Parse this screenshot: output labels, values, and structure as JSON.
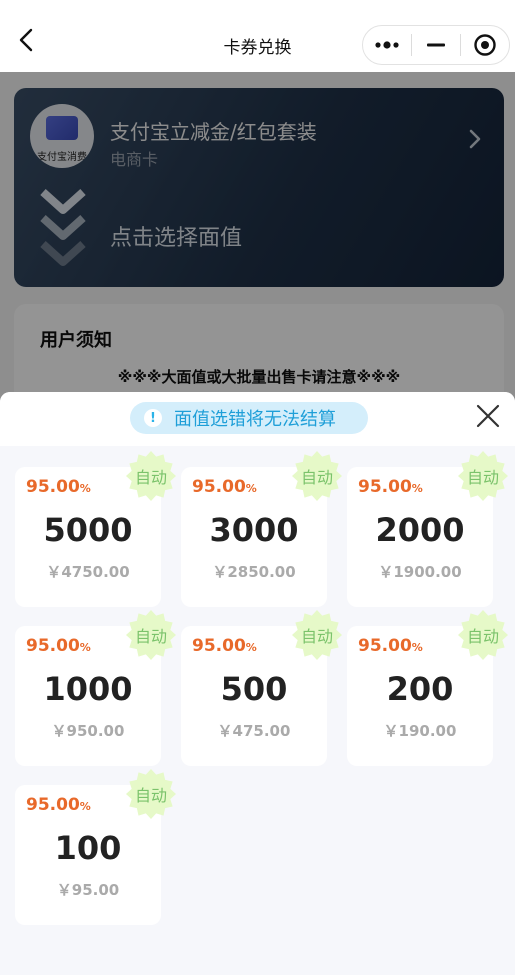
{
  "navbar": {
    "title": "卡券兑换",
    "back_icon": "chevron-left-icon",
    "more_icon": "more-dots-icon",
    "minimize_icon": "minimize-icon",
    "close_icon": "target-circle-icon"
  },
  "card": {
    "thumb_caption": "支付宝消费",
    "name": "支付宝立减金/红包套装",
    "type": "电商卡",
    "select_prompt": "点击选择面值"
  },
  "notice": {
    "title": "用户须知",
    "warning": "※※※大面值或大批量出售卡请注意※※※"
  },
  "sheet": {
    "tip": "面值选错将无法结算",
    "tip_icon": "exclamation-icon",
    "close_icon": "close-icon",
    "badge_color": "#e6f9c8",
    "rate_color": "#e8692a",
    "tiles": [
      {
        "rate": "95.00",
        "rate_unit": "%",
        "badge": "自动",
        "face": "5000",
        "price": "￥4750.00"
      },
      {
        "rate": "95.00",
        "rate_unit": "%",
        "badge": "自动",
        "face": "3000",
        "price": "￥2850.00"
      },
      {
        "rate": "95.00",
        "rate_unit": "%",
        "badge": "自动",
        "face": "2000",
        "price": "￥1900.00"
      },
      {
        "rate": "95.00",
        "rate_unit": "%",
        "badge": "自动",
        "face": "1000",
        "price": "￥950.00"
      },
      {
        "rate": "95.00",
        "rate_unit": "%",
        "badge": "自动",
        "face": "500",
        "price": "￥475.00"
      },
      {
        "rate": "95.00",
        "rate_unit": "%",
        "badge": "自动",
        "face": "200",
        "price": "￥190.00"
      },
      {
        "rate": "95.00",
        "rate_unit": "%",
        "badge": "自动",
        "face": "100",
        "price": "￥95.00"
      }
    ]
  }
}
